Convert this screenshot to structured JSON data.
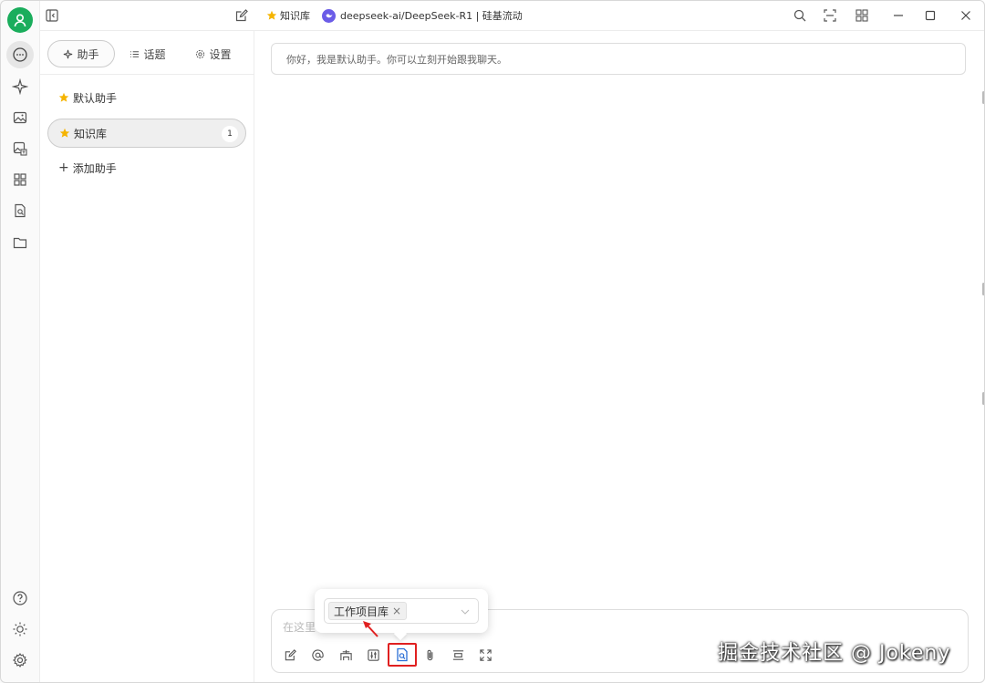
{
  "topbar": {
    "tab_kb_label": "知识库",
    "model_label": "deepseek-ai/DeepSeek-R1 | 硅基流动",
    "icons": [
      "sidebar-toggle-icon",
      "edit-icon",
      "search-icon",
      "fullscreen-icon",
      "layout-icon",
      "minimize-icon",
      "maximize-icon",
      "close-icon"
    ]
  },
  "rail": {
    "icons": [
      "avatar",
      "chat-icon",
      "sparkle-icon",
      "image-icon",
      "image-translate-icon",
      "apps-icon",
      "doc-search-icon",
      "folder-icon",
      "help-icon",
      "theme-icon",
      "settings-icon"
    ]
  },
  "sidebar": {
    "tabs": [
      {
        "label": "助手",
        "icon": "sparkle-icon"
      },
      {
        "label": "话题",
        "icon": "list-icon"
      },
      {
        "label": "设置",
        "icon": "gear-icon"
      }
    ],
    "assistants": [
      {
        "label": "默认助手",
        "icon": "star-icon"
      },
      {
        "label": "知识库",
        "icon": "star-icon",
        "badge": "1"
      }
    ],
    "add_label": "添加助手"
  },
  "main": {
    "greeting": "你好，我是默认助手。你可以立刻开始跟我聊天。",
    "input_placeholder": "在这里",
    "kb_tag": "工作项目库",
    "kb_tag_close": "×",
    "toolbar_icons": [
      "new-topic-icon",
      "mention-icon",
      "translate-icon",
      "settings-adjust-icon",
      "knowledge-base-icon",
      "attach-icon",
      "clear-icon",
      "expand-icon"
    ]
  },
  "watermark": "掘金技术社区 @ Jokeny",
  "colors": {
    "avatar_green": "#1aad5c",
    "star_yellow": "#f5b400",
    "model_purple": "#6b5ce7",
    "highlight_red": "#e02020"
  }
}
